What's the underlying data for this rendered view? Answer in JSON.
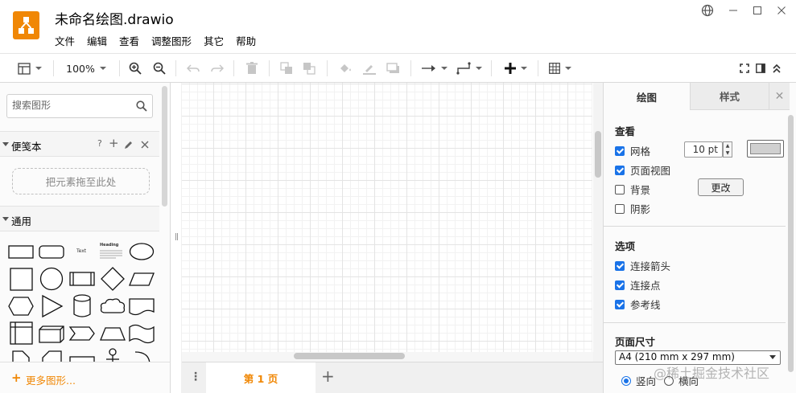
{
  "window": {
    "title": "未命名绘图.drawio",
    "menu": [
      "文件",
      "编辑",
      "查看",
      "调整图形",
      "其它",
      "帮助"
    ]
  },
  "toolbar": {
    "zoom": "100%"
  },
  "left_panel": {
    "search_placeholder": "搜索图形",
    "scratchpad": {
      "title": "便笺本",
      "help": "?",
      "drop_hint": "把元素拖至此处"
    },
    "general": {
      "title": "通用",
      "text_sample": "Text",
      "heading_sample": "Heading"
    },
    "more_shapes": "更多图形..."
  },
  "pages": {
    "current": "第 1 页"
  },
  "format_panel": {
    "tabs": [
      "绘图",
      "样式"
    ],
    "view": {
      "title": "查看",
      "grid": {
        "label": "网格",
        "checked": true,
        "size": "10 pt",
        "color": "#d0d0d0"
      },
      "page_view": {
        "label": "页面视图",
        "checked": true
      },
      "background": {
        "label": "背景",
        "checked": false,
        "button": "更改"
      },
      "shadow": {
        "label": "阴影",
        "checked": false
      }
    },
    "options": {
      "title": "选项",
      "connection_arrows": {
        "label": "连接箭头",
        "checked": true
      },
      "connection_points": {
        "label": "连接点",
        "checked": true
      },
      "guides": {
        "label": "参考线",
        "checked": true
      }
    },
    "paper_size": {
      "title": "页面尺寸",
      "value": "A4 (210 mm x 297 mm)",
      "orientation_portrait": "竖向",
      "orientation_landscape": "横向",
      "selected": "portrait"
    }
  },
  "watermark": "@稀土掘金技术社区",
  "colors": {
    "brand": "#f08705",
    "checkbox": "#1a73e8"
  }
}
